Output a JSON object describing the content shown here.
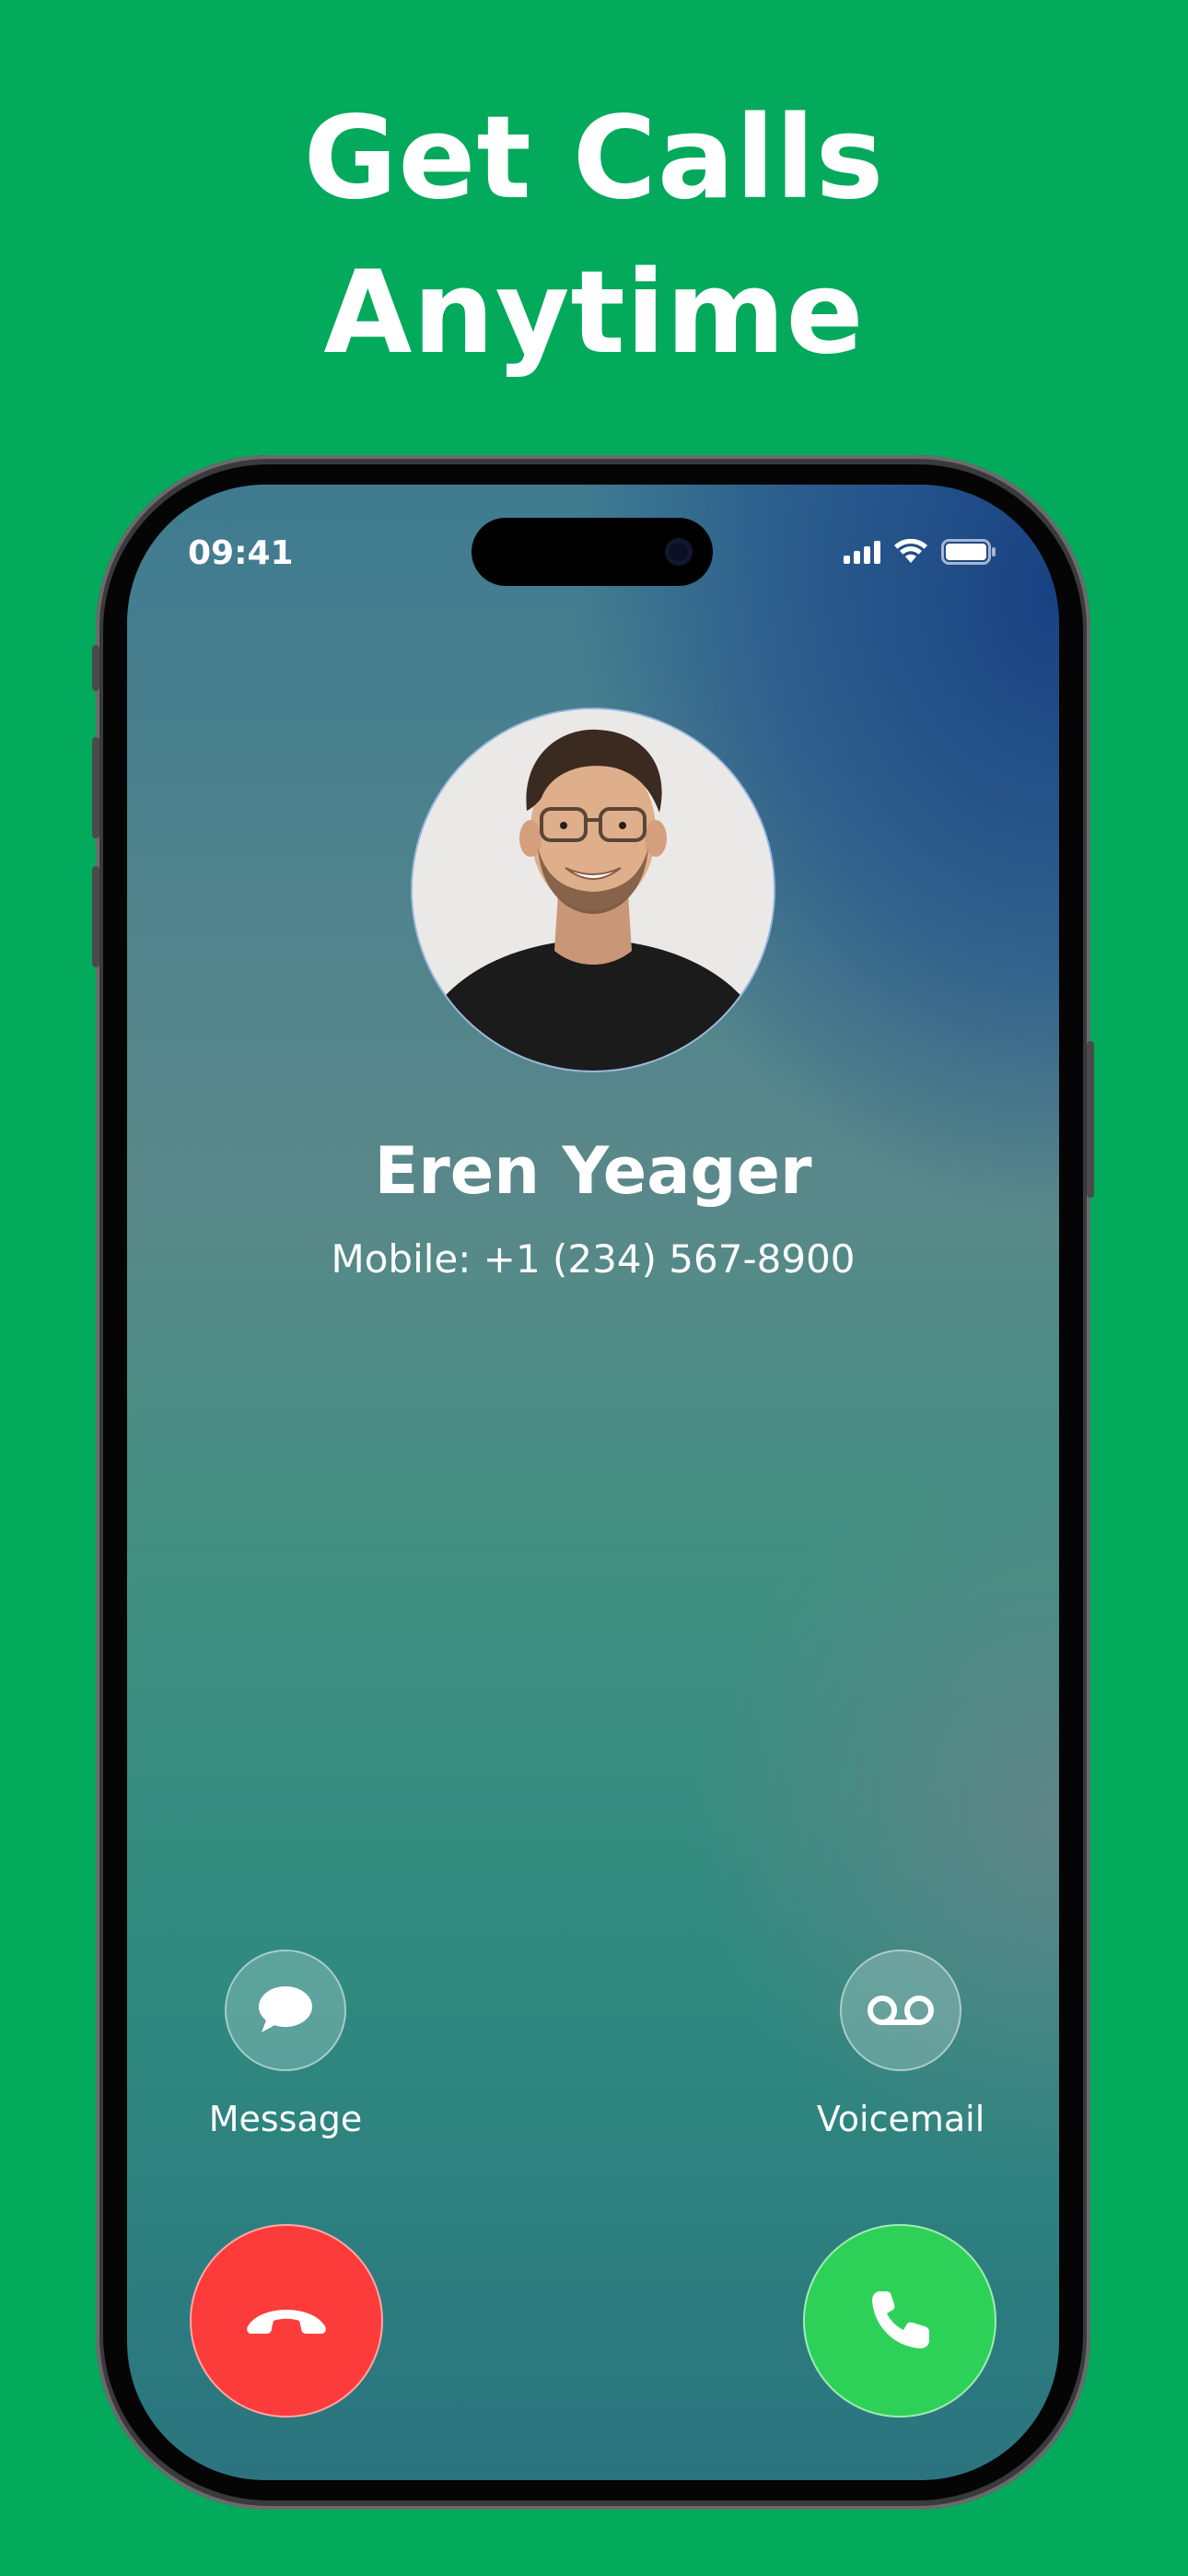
{
  "headline": {
    "line1": "Get Calls",
    "line2": "Anytime"
  },
  "status_bar": {
    "time": "09:41"
  },
  "caller": {
    "name": "Eren Yeager",
    "number": "Mobile: +1 (234) 567-8900"
  },
  "actions": {
    "message_label": "Message",
    "voicemail_label": "Voicemail"
  },
  "colors": {
    "background": "#03aa5b",
    "decline": "#fc3b3b",
    "accept": "#2ed158"
  },
  "icons": {
    "message": "message-bubble-icon",
    "voicemail": "voicemail-icon",
    "decline": "phone-hangup-icon",
    "accept": "phone-icon"
  }
}
